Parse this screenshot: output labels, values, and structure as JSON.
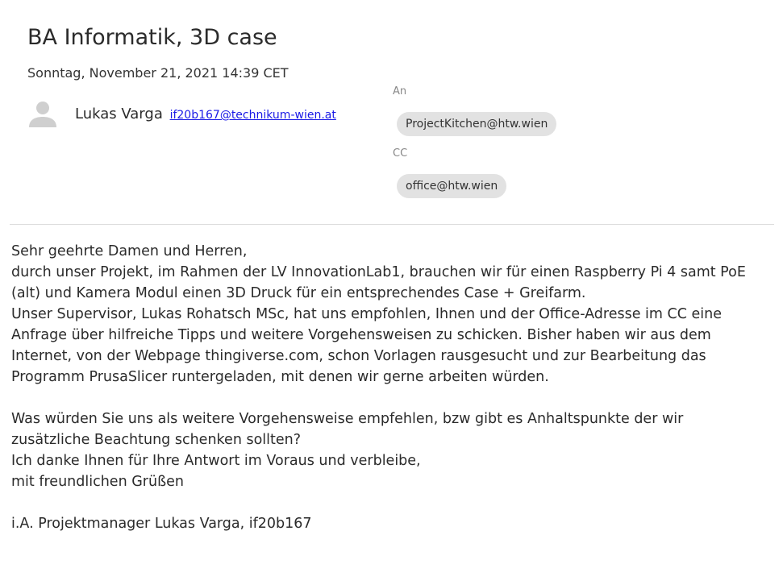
{
  "message": {
    "subject": "BA Informatik, 3D case",
    "date": "Sonntag, November 21, 2021 14:39 CET",
    "sender": {
      "name": "Lukas Varga",
      "email": "if20b167@technikum-wien.at",
      "avatar_icon": "person-silhouette-icon"
    },
    "recipients": {
      "to_label": "An",
      "to": [
        "ProjectKitchen@htw.wien"
      ],
      "cc_label": "CC",
      "cc": [
        "office@htw.wien"
      ]
    },
    "body_lines": [
      "Sehr geehrte Damen und Herren,",
      "durch unser Projekt, im Rahmen der LV InnovationLab1, brauchen wir für einen Raspberry Pi 4 samt PoE",
      "(alt) und Kamera Modul einen 3D Druck für ein entsprechendes Case + Greifarm.",
      "Unser Supervisor, Lukas Rohatsch MSc, hat uns empfohlen, Ihnen und der Office-Adresse im CC eine",
      "Anfrage über hilfreiche Tipps und weitere Vorgehensweisen zu schicken. Bisher haben wir aus dem",
      "Internet, von der Webpage thingiverse.com, schon Vorlagen rausgesucht und zur Bearbeitung das",
      "Programm PrusaSlicer runtergeladen, mit denen wir gerne arbeiten würden.",
      "",
      "Was würden Sie uns als weitere Vorgehensweise empfehlen, bzw gibt es Anhaltspunkte der wir",
      "zusätzliche Beachtung schenken sollten?",
      "Ich danke Ihnen für Ihre Antwort im Voraus und verbleibe,",
      "mit freundlichen Grüßen",
      "",
      "i.A. Projektmanager Lukas Varga, if20b167"
    ]
  },
  "colors": {
    "link": "#1a1ae6",
    "chip_background": "#e2e2e2",
    "divider": "#dddddd",
    "avatar": "#cfcfcf"
  }
}
